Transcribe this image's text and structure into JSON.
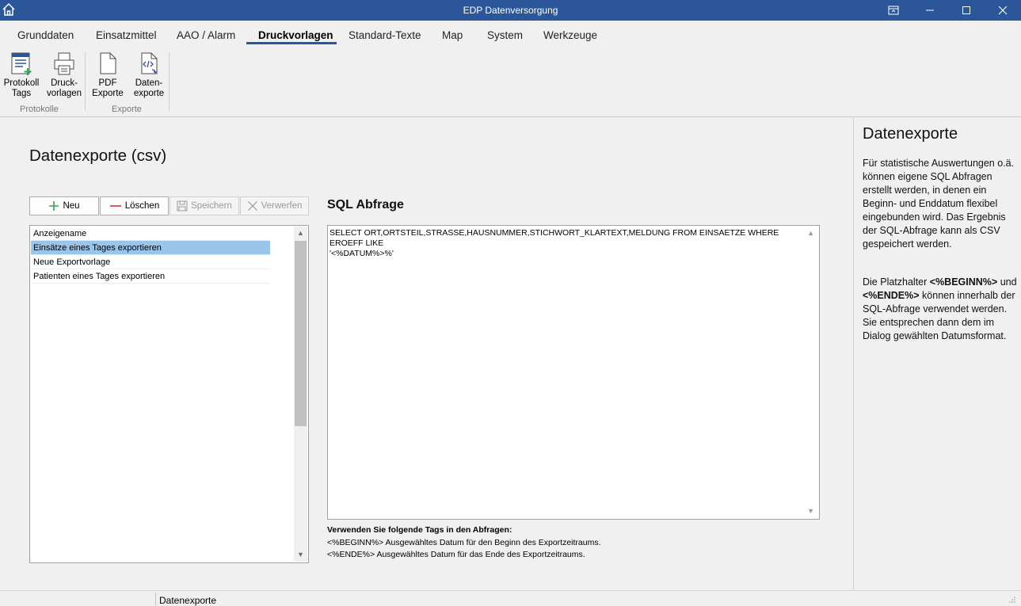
{
  "window": {
    "title": "EDP Datenversorgung",
    "accent_color": "#2b579a"
  },
  "tabs": [
    {
      "label": "Grunddaten"
    },
    {
      "label": "Einsatzmittel"
    },
    {
      "label": "AAO / Alarm"
    },
    {
      "label": "Druckvorlagen",
      "active": true
    },
    {
      "label": "Standard-Texte"
    },
    {
      "label": "Map"
    },
    {
      "label": "System"
    },
    {
      "label": "Werkzeuge"
    }
  ],
  "ribbon": {
    "buttons": [
      {
        "line1": "Protokoll",
        "line2": "Tags",
        "icon": "protocol-tags-icon"
      },
      {
        "line1": "Druck-",
        "line2": "vorlagen",
        "icon": "printer-icon"
      },
      {
        "line1": "PDF",
        "line2": "Exporte",
        "icon": "pdf-document-icon"
      },
      {
        "line1": "Daten-",
        "line2": "exporte",
        "icon": "data-export-icon"
      }
    ],
    "groups": [
      "Protokolle",
      "Exporte"
    ]
  },
  "main": {
    "page_title": "Datenexporte (csv)",
    "toolbar": {
      "new_label": "Neu",
      "delete_label": "Löschen",
      "save_label": "Speichern",
      "discard_label": "Verwerfen"
    },
    "list": {
      "header": "Anzeigename",
      "items": [
        "Einsätze eines Tages exportieren",
        "Neue Exportvorlage",
        "Patienten eines Tages exportieren"
      ],
      "selected_index": 0
    },
    "sql_title": "SQL Abfrage",
    "sql_text_line1": "SELECT ORT,ORTSTEIL,STRASSE,HAUSNUMMER,STICHWORT_KLARTEXT,MELDUNG FROM EINSAETZE WHERE EROEFF LIKE",
    "sql_text_line2": "'<%DATUM%>%'",
    "hint_title": "Verwenden Sie folgende Tags in den Abfragen:",
    "hint_begin": "<%BEGINN%> Ausgewähltes Datum für den Beginn des Exportzeitraums.",
    "hint_end": "<%ENDE%> Ausgewähltes Datum für das Ende des Exportzeitraums."
  },
  "help": {
    "title": "Datenexporte",
    "para1": "Für statistische Auswertungen o.ä. können eigene SQL Abfragen erstellt werden, in denen ein Beginn- und Enddatum flexibel eingebunden wird. Das Ergebnis der SQL-Abfrage kann als CSV gespeichert werden.",
    "para2_pre": "Die Platzhalter ",
    "para2_tag1": "<%BEGINN%>",
    "para2_mid": " und ",
    "para2_tag2": "<%ENDE%>",
    "para2_post": " können innerhalb der SQL-Abfrage verwendet werden. Sie entsprechen dann dem im Dialog gewählten Datumsformat."
  },
  "status": {
    "text": "Datenexporte"
  }
}
